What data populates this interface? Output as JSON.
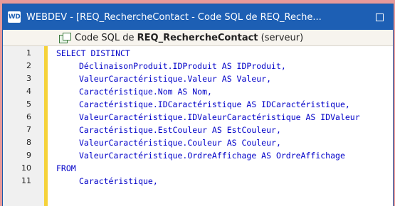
{
  "window": {
    "app_icon": "WD",
    "title": "WEBDEV - [REQ_RechercheContact - Code SQL de REQ_Reche...",
    "maximize_icon": "maximize-icon"
  },
  "panel": {
    "icon": "query-icon",
    "title_prefix": "Code SQL de ",
    "title_name": "REQ_RechercheContact",
    "title_suffix": " (serveur)"
  },
  "editor": {
    "lines": [
      {
        "num": "1",
        "indent": 0,
        "text": "SELECT DISTINCT"
      },
      {
        "num": "2",
        "indent": 1,
        "text": "DéclinaisonProduit.IDProduit AS IDProduit,"
      },
      {
        "num": "3",
        "indent": 1,
        "text": "ValeurCaractéristique.Valeur AS Valeur,"
      },
      {
        "num": "4",
        "indent": 1,
        "text": "Caractéristique.Nom AS Nom,"
      },
      {
        "num": "5",
        "indent": 1,
        "text": "Caractéristique.IDCaractéristique AS IDCaractéristique,"
      },
      {
        "num": "6",
        "indent": 1,
        "text": "ValeurCaractéristique.IDValeurCaractéristique AS IDValeur"
      },
      {
        "num": "7",
        "indent": 1,
        "text": "Caractéristique.EstCouleur AS EstCouleur,"
      },
      {
        "num": "8",
        "indent": 1,
        "text": "ValeurCaractéristique.Couleur AS Couleur,"
      },
      {
        "num": "9",
        "indent": 1,
        "text": "ValeurCaractéristique.OrdreAffichage AS OrdreAffichage"
      },
      {
        "num": "10",
        "indent": 0,
        "text": "FROM"
      },
      {
        "num": "11",
        "indent": 1,
        "text": "Caractéristique,"
      }
    ]
  },
  "colors": {
    "titlebar": "#1d5fb4",
    "code_text": "#0000c8",
    "margin_marker": "#f5d23a",
    "background": "#e79a9a"
  }
}
